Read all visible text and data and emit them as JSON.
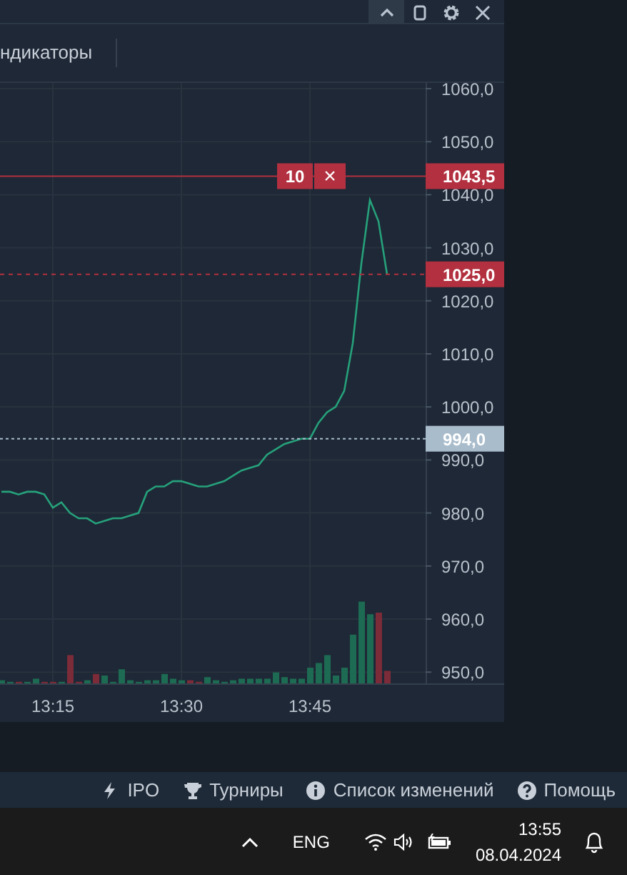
{
  "window": {
    "controls": [
      {
        "kind": "collapse",
        "selected": true
      },
      {
        "kind": "restore",
        "selected": false
      },
      {
        "kind": "settings",
        "selected": false
      },
      {
        "kind": "close",
        "selected": false
      }
    ]
  },
  "toolbar": {
    "items": [
      {
        "label": "ндикаторы"
      }
    ]
  },
  "chart": {
    "chart_data": {
      "type": "line",
      "categories": [
        null,
        null,
        null,
        null,
        null,
        null,
        "13:15",
        null,
        null,
        null,
        null,
        null,
        null,
        null,
        null,
        null,
        null,
        null,
        null,
        null,
        null,
        "13:30",
        null,
        null,
        null,
        null,
        null,
        null,
        null,
        null,
        null,
        null,
        null,
        null,
        null,
        null,
        "13:45",
        null,
        null,
        null,
        null,
        null,
        null,
        null,
        null,
        null
      ],
      "grid": true,
      "series": [
        {
          "color": "#26a17b",
          "values": [
            984,
            984,
            983.5,
            984,
            984,
            983.5,
            981,
            982,
            980,
            979,
            979,
            978,
            978.5,
            979,
            979,
            979.5,
            980,
            984,
            985,
            985,
            986,
            986,
            985.5,
            985,
            985,
            985.5,
            986,
            987,
            988,
            988.5,
            989,
            991,
            992,
            993,
            993.5,
            994,
            994,
            997,
            999,
            1000,
            1003,
            1012,
            1027,
            1039,
            1035,
            1025
          ]
        }
      ],
      "ylim": [
        948,
        1061
      ],
      "yticks": [
        {
          "value": 1060,
          "label": "1060,0"
        },
        {
          "value": 1050,
          "label": "1050,0"
        },
        {
          "value": 1040,
          "label": "1040,0"
        },
        {
          "value": 1030,
          "label": "1030,0"
        },
        {
          "value": 1020,
          "label": "1020,0"
        },
        {
          "value": 1010,
          "label": "1010,0"
        },
        {
          "value": 1000,
          "label": "1000,0"
        },
        {
          "value": 990,
          "label": "990,0"
        },
        {
          "value": 980,
          "label": "980,0"
        },
        {
          "value": 970,
          "label": "970,0"
        },
        {
          "value": 960,
          "label": "960,0"
        },
        {
          "value": 950,
          "label": "950,0"
        }
      ],
      "ref_lines": [
        {
          "axis": "y",
          "value": 1043.5,
          "label": "1043,5",
          "color": "#b2303f"
        },
        {
          "axis": "y",
          "value": 1025,
          "label": "1025,0",
          "color": "#b2303f"
        },
        {
          "axis": "y",
          "value": 994,
          "label": "994,0",
          "color": "#a9bccb"
        }
      ]
    },
    "order": {
      "quantity": "10",
      "cancel": "×"
    }
  },
  "status_bar": {
    "items": [
      {
        "kind": "bolt",
        "label": "IPO"
      },
      {
        "kind": "trophy",
        "label": "Турниры"
      },
      {
        "kind": "info",
        "label": "Список изменений"
      },
      {
        "kind": "help",
        "label": "Помощь"
      }
    ]
  },
  "taskbar": {
    "language": "ENG",
    "time": "13:55",
    "date": "08.04.2024"
  }
}
